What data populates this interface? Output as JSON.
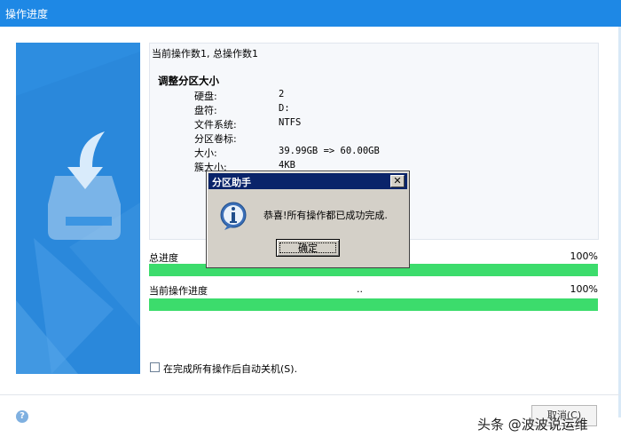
{
  "window": {
    "title": "操作进度"
  },
  "info": {
    "line1": "当前操作数1, 总操作数1",
    "section_title": "调整分区大小",
    "rows": [
      {
        "k": "硬盘:",
        "v": "2"
      },
      {
        "k": "盘符:",
        "v": "D:"
      },
      {
        "k": "文件系统:",
        "v": "NTFS"
      },
      {
        "k": "分区卷标:",
        "v": ""
      },
      {
        "k": "大小:",
        "v": "39.99GB => 60.00GB"
      },
      {
        "k": "簇大小:",
        "v": "4KB"
      }
    ]
  },
  "progress": {
    "total_label": "总进度",
    "total_pct_text": "100%",
    "total_value": 1.0,
    "current_label": "当前操作进度",
    "current_mid": "..",
    "current_pct_text": "100%",
    "current_value": 1.0
  },
  "options": {
    "auto_shutdown_label": "在完成所有操作后自动关机(S)."
  },
  "buttons": {
    "cancel": "取消(C)"
  },
  "dialog": {
    "title": "分区助手",
    "close": "✕",
    "message": "恭喜!所有操作都已成功完成.",
    "ok": "确定"
  },
  "watermark": "头条 @波波说运维",
  "help_glyph": "?",
  "colors": {
    "titlebar": "#1e88e5",
    "left_panel": "#2d8de0",
    "progress_fill": "#3cdc6c",
    "dialog_title": "#0a246a"
  }
}
